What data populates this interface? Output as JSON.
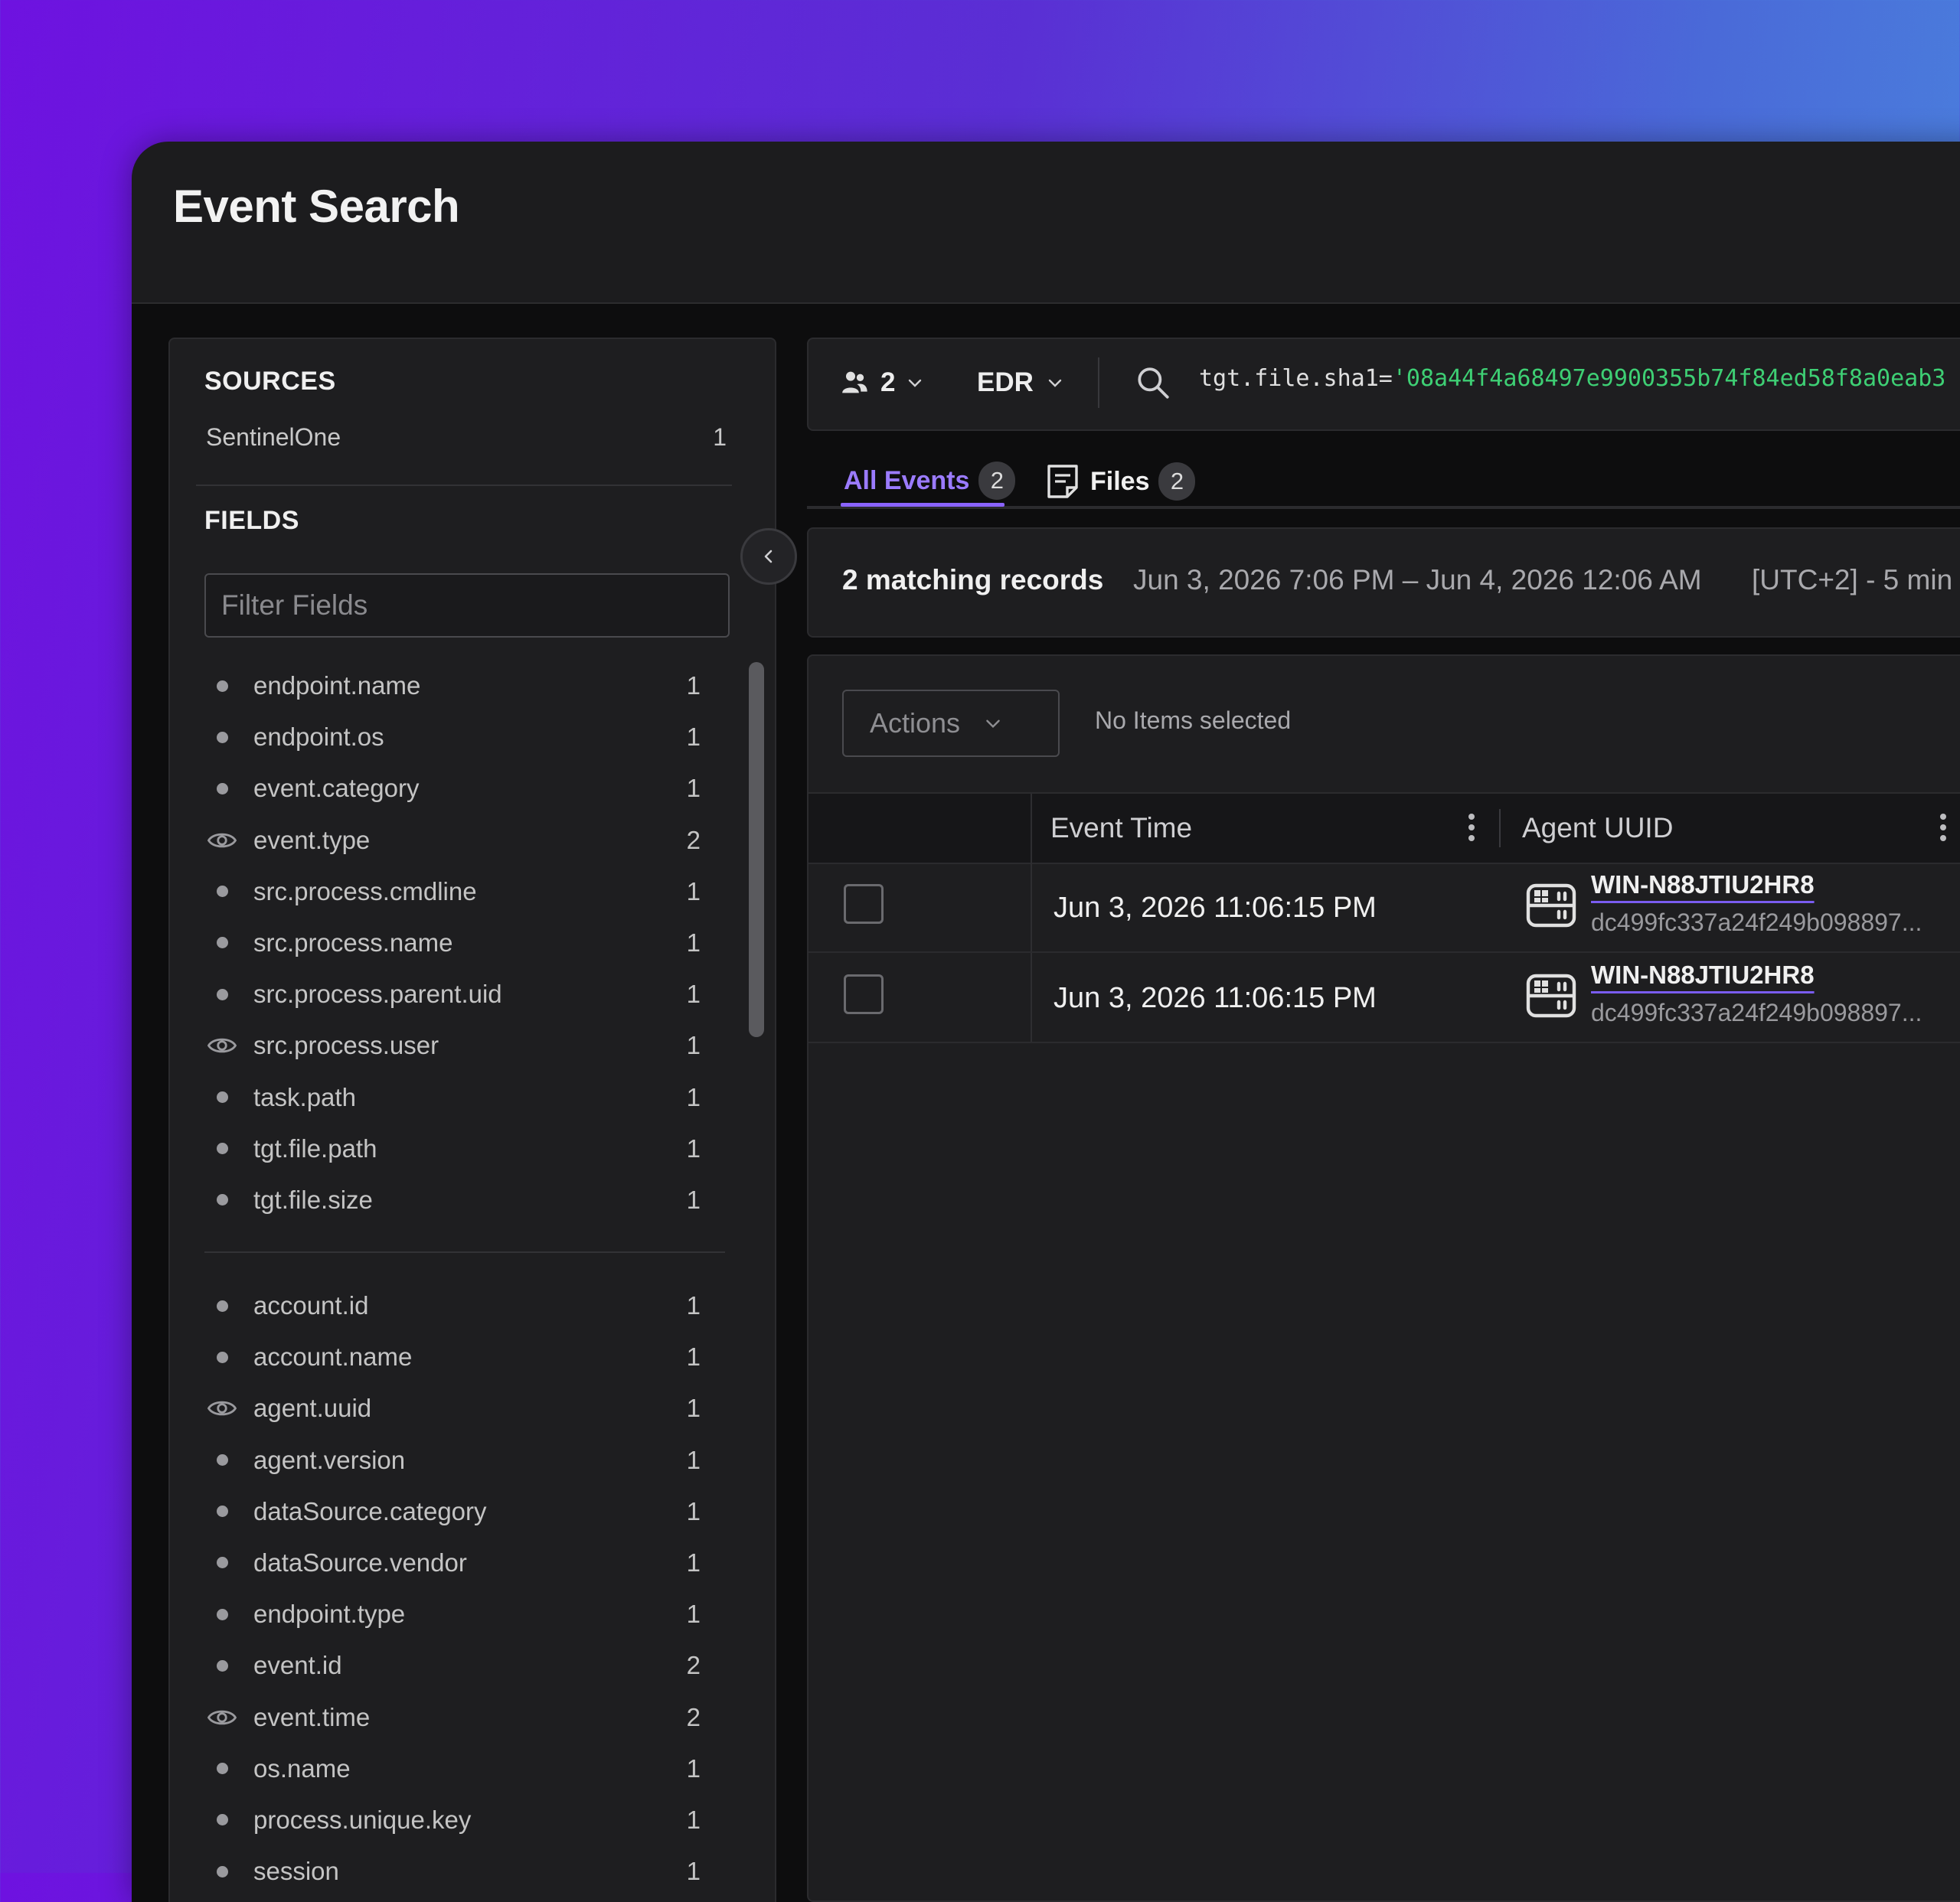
{
  "page": {
    "title": "Event Search"
  },
  "sidebar": {
    "sources_title": "SOURCES",
    "sources": [
      {
        "name": "SentinelOne",
        "count": "1"
      }
    ],
    "fields_title": "FIELDS",
    "filter_placeholder": "Filter Fields",
    "fields_group1": [
      {
        "name": "endpoint.name",
        "count": "1",
        "icon": "dot"
      },
      {
        "name": "endpoint.os",
        "count": "1",
        "icon": "dot"
      },
      {
        "name": "event.category",
        "count": "1",
        "icon": "dot"
      },
      {
        "name": "event.type",
        "count": "2",
        "icon": "eye"
      },
      {
        "name": "src.process.cmdline",
        "count": "1",
        "icon": "dot"
      },
      {
        "name": "src.process.name",
        "count": "1",
        "icon": "dot"
      },
      {
        "name": "src.process.parent.uid",
        "count": "1",
        "icon": "dot"
      },
      {
        "name": "src.process.user",
        "count": "1",
        "icon": "eye"
      },
      {
        "name": "task.path",
        "count": "1",
        "icon": "dot"
      },
      {
        "name": "tgt.file.path",
        "count": "1",
        "icon": "dot"
      },
      {
        "name": "tgt.file.size",
        "count": "1",
        "icon": "dot"
      }
    ],
    "fields_group2": [
      {
        "name": "account.id",
        "count": "1",
        "icon": "dot"
      },
      {
        "name": "account.name",
        "count": "1",
        "icon": "dot"
      },
      {
        "name": "agent.uuid",
        "count": "1",
        "icon": "eye"
      },
      {
        "name": "agent.version",
        "count": "1",
        "icon": "dot"
      },
      {
        "name": "dataSource.category",
        "count": "1",
        "icon": "dot"
      },
      {
        "name": "dataSource.vendor",
        "count": "1",
        "icon": "dot"
      },
      {
        "name": "endpoint.type",
        "count": "1",
        "icon": "dot"
      },
      {
        "name": "event.id",
        "count": "2",
        "icon": "dot"
      },
      {
        "name": "event.time",
        "count": "2",
        "icon": "eye"
      },
      {
        "name": "os.name",
        "count": "1",
        "icon": "dot"
      },
      {
        "name": "process.unique.key",
        "count": "1",
        "icon": "dot"
      },
      {
        "name": "session",
        "count": "1",
        "icon": "dot"
      }
    ]
  },
  "querybar": {
    "scope_count": "2",
    "source": "EDR",
    "query_prefix": "tgt.file.sha1=",
    "query_value": "'08a44f4a68497e9900355b74f84ed58f8a0eab3"
  },
  "tabs": [
    {
      "label": "All Events",
      "count": "2",
      "active": true
    },
    {
      "label": "Files",
      "count": "2",
      "active": false
    }
  ],
  "summary": {
    "count_text": "2 matching records",
    "range": "Jun 3, 2026 7:06 PM – Jun 4, 2026 12:06 AM",
    "timezone": "[UTC+2] - 5 min"
  },
  "grid": {
    "actions_label": "Actions",
    "selection_status": "No Items selected",
    "columns": [
      "Event Time",
      "Agent UUID"
    ],
    "rows": [
      {
        "event_time": "Jun 3, 2026 11:06:15 PM",
        "agent_name": "WIN-N88JTIU2HR8",
        "agent_uuid": "dc499fc337a24f249b098897..."
      },
      {
        "event_time": "Jun 3, 2026 11:06:15 PM",
        "agent_name": "WIN-N88JTIU2HR8",
        "agent_uuid": "dc499fc337a24f249b098897..."
      }
    ]
  },
  "colors": {
    "accent": "#8a63ff",
    "query_string": "#3ecf74"
  }
}
